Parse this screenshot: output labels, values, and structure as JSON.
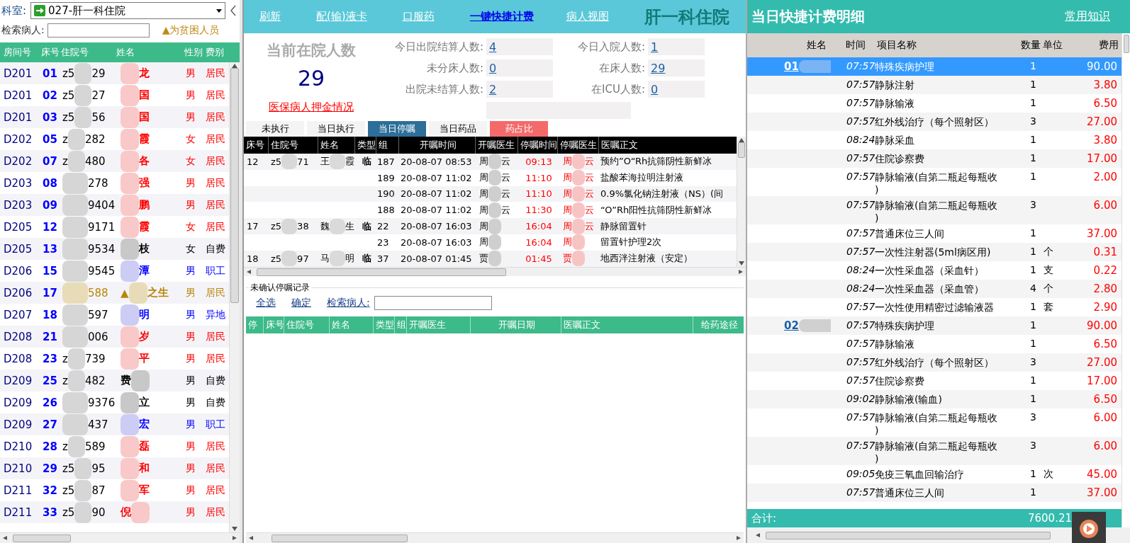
{
  "department": {
    "label": "科室:",
    "value": "027-肝一科住院"
  },
  "patient_search": {
    "label": "检索病人:"
  },
  "poverty_note": "▲为贫困人员",
  "patients": {
    "columns": [
      "房间号",
      "床号",
      "住院号",
      "姓名",
      "性别",
      "费别"
    ],
    "rows": [
      {
        "room": "D201",
        "bed": "01",
        "zyh_head": "z5",
        "zyh_tail": "29",
        "name_tail": "龙",
        "gender": "男",
        "fee_type": "居民",
        "color": "#ff0000"
      },
      {
        "room": "D201",
        "bed": "02",
        "zyh_head": "z5",
        "zyh_tail": "27",
        "name_tail": "国",
        "gender": "男",
        "fee_type": "居民",
        "color": "#ff0000"
      },
      {
        "room": "D201",
        "bed": "03",
        "zyh_head": "z5",
        "zyh_tail": "56",
        "name_tail": "国",
        "gender": "男",
        "fee_type": "居民",
        "color": "#ff0000"
      },
      {
        "room": "D202",
        "bed": "05",
        "zyh_head": "z",
        "zyh_tail": "282",
        "name_tail": "霞",
        "gender": "女",
        "fee_type": "居民",
        "color": "#ff0000"
      },
      {
        "room": "D202",
        "bed": "07",
        "zyh_head": "z",
        "zyh_tail": "480",
        "name_tail": "各",
        "gender": "女",
        "fee_type": "居民",
        "color": "#ff0000"
      },
      {
        "room": "D203",
        "bed": "08",
        "zyh_tail": "278",
        "name_tail": "强",
        "gender": "男",
        "fee_type": "居民",
        "color": "#ff0000"
      },
      {
        "room": "D203",
        "bed": "09",
        "zyh_tail": "9404",
        "name_tail": "鹏",
        "gender": "男",
        "fee_type": "居民",
        "color": "#ff0000"
      },
      {
        "room": "D205",
        "bed": "12",
        "zyh_tail": "9171",
        "name_tail": "霞",
        "gender": "女",
        "fee_type": "居民",
        "color": "#ff0000"
      },
      {
        "room": "D205",
        "bed": "13",
        "zyh_tail": "9534",
        "name_tail": "枝",
        "gender": "女",
        "fee_type": "自费",
        "color": "#000000"
      },
      {
        "room": "D206",
        "bed": "15",
        "zyh_tail": "9545",
        "name_tail": "潭",
        "gender": "男",
        "fee_type": "职工",
        "color": "#0000ff"
      },
      {
        "room": "D206",
        "bed": "17",
        "zyh_tail": "588",
        "name_head": "▲",
        "name_tail": "之生",
        "gender": "男",
        "fee_type": "居民",
        "color": "#b8860b"
      },
      {
        "room": "D207",
        "bed": "18",
        "zyh_tail": "597",
        "name_tail": "明",
        "gender": "男",
        "fee_type": "异地",
        "color": "#0000ff"
      },
      {
        "room": "D208",
        "bed": "21",
        "zyh_tail": "006",
        "name_tail": "岁",
        "gender": "男",
        "fee_type": "居民",
        "color": "#ff0000"
      },
      {
        "room": "D208",
        "bed": "23",
        "zyh_head": "z",
        "zyh_tail": "739",
        "name_tail": "平",
        "gender": "男",
        "fee_type": "居民",
        "color": "#ff0000"
      },
      {
        "room": "D209",
        "bed": "25",
        "zyh_head": "z",
        "zyh_tail": "482",
        "name_head": "费",
        "gender": "男",
        "fee_type": "自费",
        "color": "#000000"
      },
      {
        "room": "D209",
        "bed": "26",
        "zyh_tail": "9376",
        "name_tail": "立",
        "gender": "男",
        "fee_type": "自费",
        "color": "#000000"
      },
      {
        "room": "D209",
        "bed": "27",
        "zyh_tail": "437",
        "name_tail": "宏",
        "gender": "男",
        "fee_type": "职工",
        "color": "#0000ff"
      },
      {
        "room": "D210",
        "bed": "28",
        "zyh_head": "z",
        "zyh_tail": "589",
        "name_tail": "磊",
        "gender": "男",
        "fee_type": "居民",
        "color": "#ff0000"
      },
      {
        "room": "D210",
        "bed": "29",
        "zyh_head": "z5",
        "zyh_tail": "95",
        "name_tail": "和",
        "gender": "男",
        "fee_type": "居民",
        "color": "#ff0000"
      },
      {
        "room": "D211",
        "bed": "32",
        "zyh_head": "z5",
        "zyh_tail": "87",
        "name_tail": "军",
        "gender": "男",
        "fee_type": "居民",
        "color": "#ff0000"
      },
      {
        "room": "D211",
        "bed": "33",
        "zyh_head": "z5",
        "zyh_tail": "90",
        "name_head": "倪",
        "gender": "男",
        "fee_type": "居民",
        "color": "#ff0000"
      }
    ]
  },
  "toolbar": {
    "links": [
      {
        "label": "刷新",
        "kind": "plain"
      },
      {
        "label": "配(输)液卡",
        "kind": "plain"
      },
      {
        "label": "口服药",
        "kind": "plain"
      },
      {
        "label": "一键快捷计费",
        "kind": "primary"
      },
      {
        "label": "病人视图",
        "kind": "plain"
      }
    ],
    "title": "肝一科住院"
  },
  "stats": {
    "title": "当前在院人数",
    "count": "29",
    "deposit_link": "医保病人押金情况",
    "items": [
      {
        "label": "今日出院结算人数:",
        "value": "4"
      },
      {
        "label": "今日入院人数:",
        "value": "1"
      },
      {
        "label": "未分床人数:",
        "value": "0"
      },
      {
        "label": "在床人数:",
        "value": "29"
      },
      {
        "label": "出院未结算人数:",
        "value": "2"
      },
      {
        "label": "在ICU人数:",
        "value": "0"
      }
    ]
  },
  "tabs": [
    {
      "label": "未执行",
      "selected": false,
      "kind": "normal"
    },
    {
      "label": "当日执行",
      "selected": false,
      "kind": "normal"
    },
    {
      "label": "当日停嘱",
      "selected": true,
      "kind": "normal"
    },
    {
      "label": "当日药品",
      "selected": false,
      "kind": "normal"
    },
    {
      "label": "药占比",
      "selected": false,
      "kind": "alert"
    }
  ],
  "orders": {
    "columns": [
      "床号",
      "住院号",
      "姓名",
      "类型",
      "组",
      "开嘱时间",
      "开嘱医生",
      "停嘱时间",
      "停嘱医生",
      "医嘱正文"
    ],
    "rows": [
      {
        "bed": "12",
        "zyh_head": "z5",
        "zyh_tail": "71",
        "name_head": "王",
        "name_tail": "霞",
        "type": "临",
        "group": "187",
        "start": "20-08-07 08:53",
        "doctor_head": "周",
        "doctor_tail": "云",
        "stop": "09:13",
        "stop_doctor_head": "周",
        "stop_doctor_tail": "云",
        "text": "预约”O“Rh抗筛阴性新鲜冰"
      },
      {
        "group": "189",
        "start": "20-08-07 11:02",
        "doctor_head": "周",
        "doctor_tail": "云",
        "stop": "11:10",
        "stop_doctor_head": "周",
        "stop_doctor_tail": "云",
        "text": "盐酸苯海拉明注射液"
      },
      {
        "group": "190",
        "start": "20-08-07 11:02",
        "doctor_head": "周",
        "doctor_tail": "云",
        "stop": "11:10",
        "stop_doctor_head": "周",
        "stop_doctor_tail": "云",
        "text": "0.9%氯化钠注射液（NS）(间"
      },
      {
        "group": "188",
        "start": "20-08-07 11:02",
        "doctor_head": "周",
        "doctor_tail": "云",
        "stop": "11:30",
        "stop_doctor_head": "周",
        "stop_doctor_tail": "云",
        "text": " “O”Rh阳性抗筛阴性新鲜冰"
      },
      {
        "bed": "17",
        "zyh_head": "z5",
        "zyh_tail": "38",
        "name_head": "魏",
        "name_tail": "生",
        "type": "临",
        "group": "22",
        "start": "20-08-07 16:03",
        "doctor_head": "周",
        "stop": "16:04",
        "stop_doctor_head": "周",
        "stop_doctor_tail": "云",
        "text": "静脉留置针"
      },
      {
        "group": "23",
        "start": "20-08-07 16:03",
        "doctor_head": "周",
        "stop": "16:04",
        "stop_doctor_head": "周",
        "text": "留置针护理2次"
      },
      {
        "bed": "18",
        "zyh_head": "z5",
        "zyh_tail": "97",
        "name_head": "马",
        "name_tail": "明",
        "type": "临",
        "group": "37",
        "start": "20-08-07 01:45",
        "doctor_head": "贾",
        "stop": "01:45",
        "stop_doctor_head": "贾",
        "text": "地西泮注射液（安定）"
      }
    ]
  },
  "unconfirmed": {
    "title": "未确认停嘱记录",
    "links": [
      "全选",
      "确定"
    ],
    "search_label": "检索病人:",
    "columns": [
      "停",
      "床号",
      "住院号",
      "姓名",
      "类型",
      "组",
      "开嘱医生",
      "开嘱日期",
      "医嘱正文",
      "给药途径"
    ]
  },
  "billing": {
    "title": "当日快捷计费明细",
    "link": "常用知识",
    "columns": [
      "姓名",
      "时间",
      "项目名称",
      "数量",
      "单位",
      "费用"
    ],
    "rows": [
      {
        "patient": "01",
        "time": "07:57",
        "item": "特殊疾病护理",
        "qty": "1",
        "fee": "90.00",
        "selected": true
      },
      {
        "time": "07:57",
        "item": "静脉注射",
        "qty": "1",
        "fee": "3.80",
        "selected": false
      },
      {
        "time": "07:57",
        "item": "静脉输液",
        "qty": "1",
        "fee": "6.50",
        "selected": false
      },
      {
        "time": "07:57",
        "item": "红外线治疗（每个照射区）",
        "qty": "3",
        "fee": "27.00",
        "selected": false
      },
      {
        "time": "08:24",
        "item": "静脉采血",
        "qty": "1",
        "fee": "3.80",
        "selected": false
      },
      {
        "time": "07:57",
        "item": "住院诊察费",
        "qty": "1",
        "fee": "17.00",
        "selected": false
      },
      {
        "time": "07:57",
        "item": "静脉输液(自第二瓶起每瓶收)",
        "qty": "1",
        "fee": "2.00",
        "selected": false
      },
      {
        "time": "07:57",
        "item": "静脉输液(自第二瓶起每瓶收)",
        "qty": "3",
        "fee": "6.00",
        "selected": false
      },
      {
        "time": "07:57",
        "item": "普通床位三人间",
        "qty": "1",
        "fee": "37.00",
        "selected": false
      },
      {
        "time": "07:57",
        "item": "一次性注射器(5ml病区用)",
        "qty": "1",
        "unit": "个",
        "fee": "0.31",
        "selected": false
      },
      {
        "time": "08:24",
        "item": "一次性采血器（采血针）",
        "qty": "1",
        "unit": "支",
        "fee": "0.22",
        "selected": false
      },
      {
        "time": "08:24",
        "item": "一次性采血器（采血管）",
        "qty": "4",
        "unit": "个",
        "fee": "2.80",
        "selected": false
      },
      {
        "time": "07:57",
        "item": "一次性使用精密过滤输液器",
        "qty": "1",
        "unit": "套",
        "fee": "2.90",
        "selected": false
      },
      {
        "patient": "02",
        "time": "07:57",
        "item": "特殊疾病护理",
        "qty": "1",
        "fee": "90.00",
        "selected": false
      },
      {
        "time": "07:57",
        "item": "静脉输液",
        "qty": "1",
        "fee": "6.50",
        "selected": false
      },
      {
        "time": "07:57",
        "item": "红外线治疗（每个照射区）",
        "qty": "3",
        "fee": "27.00",
        "selected": false
      },
      {
        "time": "07:57",
        "item": "住院诊察费",
        "qty": "1",
        "fee": "17.00",
        "selected": false
      },
      {
        "time": "09:02",
        "item": "静脉输液(输血)",
        "qty": "1",
        "fee": "6.50",
        "selected": false
      },
      {
        "time": "07:57",
        "item": "静脉输液(自第二瓶起每瓶收)",
        "qty": "3",
        "fee": "6.00",
        "selected": false
      },
      {
        "time": "07:57",
        "item": "静脉输液(自第二瓶起每瓶收)",
        "qty": "3",
        "fee": "6.00",
        "selected": false
      },
      {
        "time": "09:05",
        "item": "免疫三氧血回输治疗",
        "qty": "1",
        "unit": "次",
        "fee": "45.00",
        "selected": false
      },
      {
        "time": "07:57",
        "item": "普通床位三人间",
        "qty": "1",
        "fee": "37.00",
        "selected": false
      }
    ],
    "total_label": "合计:",
    "total": "7600.21"
  }
}
